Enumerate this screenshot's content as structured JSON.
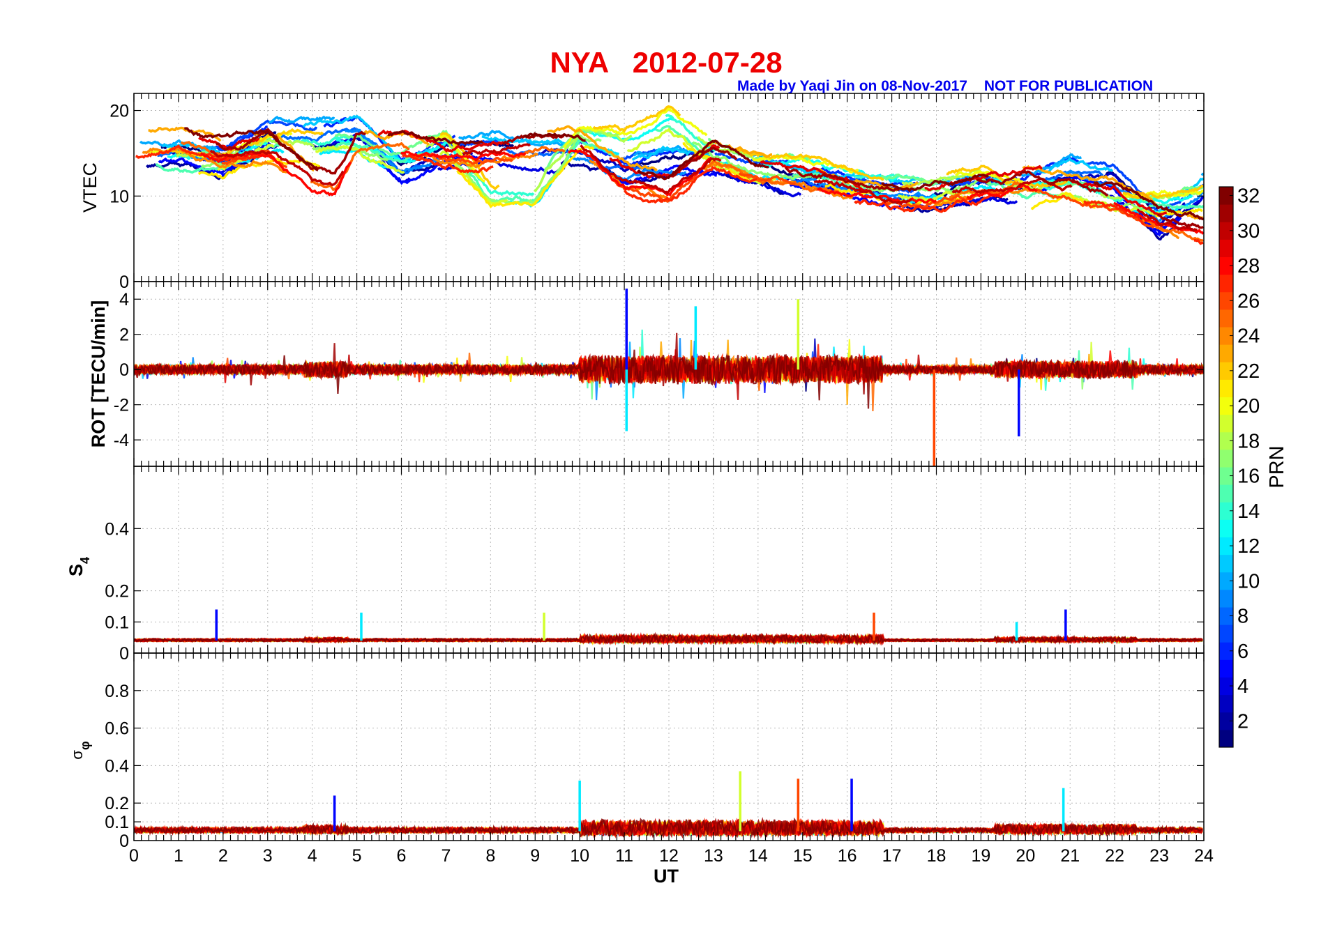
{
  "chart_data": {
    "type": "line",
    "title": "NYA   2012-07-28",
    "credit": "Made by Yaqi Jin on 08-Nov-2017",
    "notice": "NOT FOR PUBLICATION",
    "xlabel": "UT",
    "xlim": [
      0,
      24
    ],
    "x_ticks": [
      "0",
      "1",
      "2",
      "3",
      "4",
      "5",
      "6",
      "7",
      "8",
      "9",
      "10",
      "11",
      "12",
      "13",
      "14",
      "15",
      "16",
      "17",
      "18",
      "19",
      "20",
      "21",
      "22",
      "23",
      "24"
    ],
    "grid": true,
    "colorbar": {
      "label": "PRN",
      "range": [
        1,
        32
      ],
      "ticks": [
        "2",
        "4",
        "6",
        "8",
        "10",
        "12",
        "14",
        "16",
        "18",
        "20",
        "22",
        "24",
        "26",
        "28",
        "30",
        "32"
      ],
      "colormap": "jet"
    },
    "panels": [
      {
        "id": "vtec",
        "ylabel": "VTEC",
        "ylim": [
          0,
          22
        ],
        "y_ticks": [
          "0",
          "10",
          "20"
        ],
        "series_summary": [
          {
            "prn_group": "high",
            "x": [
              0,
              1,
              2,
              3,
              4,
              4.5,
              5,
              6,
              7,
              8,
              9,
              10,
              11,
              12,
              13,
              14,
              15,
              16,
              17,
              18,
              19,
              20,
              21,
              22,
              23,
              24
            ],
            "y": [
              16,
              17,
              15,
              16,
              12,
              11,
              16,
              16,
              15,
              15,
              16,
              16,
              12,
              11,
              15,
              13,
              12,
              11,
              10,
              10,
              11,
              12,
              11,
              10,
              7,
              6
            ]
          },
          {
            "prn_group": "mid",
            "x": [
              0,
              1,
              2,
              3,
              4,
              5,
              6,
              7,
              8,
              9,
              10,
              11,
              12,
              13,
              14,
              15,
              16,
              17,
              18,
              19,
              20,
              21,
              22,
              23,
              24
            ],
            "y": [
              14,
              14,
              14,
              16,
              16,
              16,
              14,
              16,
              10,
              10,
              17,
              16,
              19,
              15,
              13,
              13,
              12,
              11,
              11,
              12,
              10,
              11,
              9,
              9,
              10
            ]
          },
          {
            "prn_group": "low",
            "x": [
              0,
              1,
              2,
              3,
              4,
              5,
              6,
              7,
              8,
              9,
              10,
              11,
              12,
              13,
              14,
              15,
              16,
              17,
              18,
              19,
              20,
              21,
              22,
              23,
              24
            ],
            "y": [
              15,
              15,
              14,
              17,
              17,
              18,
              13,
              15,
              16,
              15,
              15,
              13,
              14,
              14,
              13,
              12,
              11,
              10,
              10,
              11,
              11,
              13,
              12,
              7,
              11
            ]
          }
        ]
      },
      {
        "id": "rot",
        "ylabel": "ROT [TECU/min]",
        "ylim": [
          -5.5,
          5
        ],
        "y_ticks": [
          "-4",
          "-2",
          "0",
          "2",
          "4"
        ],
        "peak_events": [
          {
            "x": 11.05,
            "y": 4.6
          },
          {
            "x": 11.05,
            "y": -3.5
          },
          {
            "x": 14.9,
            "y": 4.0
          },
          {
            "x": 17.95,
            "y": -5.5
          },
          {
            "x": 19.85,
            "y": -3.8
          },
          {
            "x": 12.6,
            "y": 3.6
          }
        ]
      },
      {
        "id": "s4",
        "ylabel": "S4",
        "ylim": [
          0,
          0.6
        ],
        "y_ticks": [
          "0",
          "0.1",
          "0.2",
          "0.4"
        ],
        "baseline": 0.04,
        "peak_events": [
          {
            "x": 1.85,
            "y": 0.14
          },
          {
            "x": 5.1,
            "y": 0.13
          },
          {
            "x": 9.2,
            "y": 0.13
          },
          {
            "x": 16.6,
            "y": 0.13
          },
          {
            "x": 20.9,
            "y": 0.14
          },
          {
            "x": 19.8,
            "y": 0.1
          }
        ]
      },
      {
        "id": "sigma_phi",
        "ylabel": "σφ",
        "ylim": [
          0,
          1.0
        ],
        "y_ticks": [
          "0",
          "0.1",
          "0.2",
          "0.4",
          "0.6",
          "0.8"
        ],
        "baseline": 0.05,
        "peak_events": [
          {
            "x": 4.5,
            "y": 0.24
          },
          {
            "x": 10.0,
            "y": 0.32
          },
          {
            "x": 13.6,
            "y": 0.37
          },
          {
            "x": 14.9,
            "y": 0.33
          },
          {
            "x": 16.1,
            "y": 0.33
          },
          {
            "x": 20.85,
            "y": 0.28
          }
        ]
      }
    ]
  }
}
